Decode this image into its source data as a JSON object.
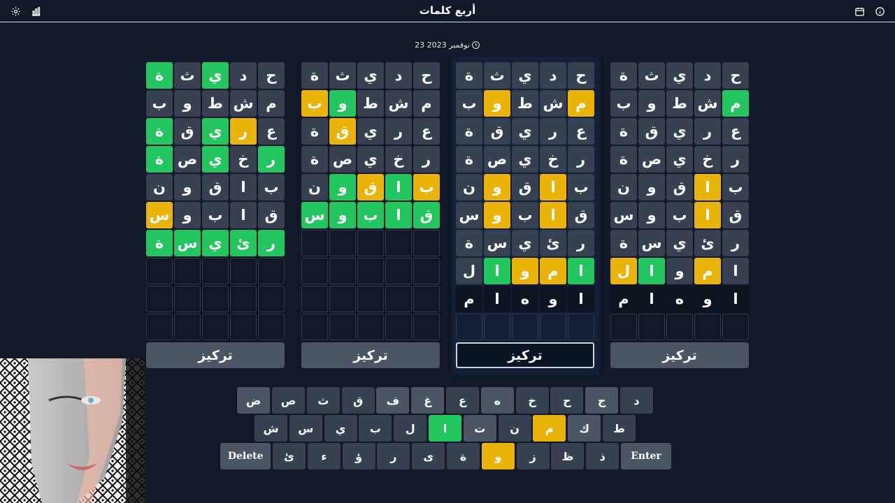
{
  "header": {
    "title": "أربع كلمات"
  },
  "date": {
    "text": "23 نوفمبر 2023"
  },
  "boards": [
    {
      "rows": [
        {
          "letters": [
            "ح",
            "د",
            "ي",
            "ث",
            "ة"
          ],
          "states": [
            "n",
            "n",
            "n",
            "n",
            "n"
          ]
        },
        {
          "letters": [
            "م",
            "ش",
            "ط",
            "و",
            "ب"
          ],
          "states": [
            "g",
            "n",
            "n",
            "n",
            "n"
          ]
        },
        {
          "letters": [
            "ع",
            "ر",
            "ي",
            "ق",
            "ة"
          ],
          "states": [
            "n",
            "n",
            "n",
            "n",
            "n"
          ]
        },
        {
          "letters": [
            "ر",
            "خ",
            "ي",
            "ص",
            "ة"
          ],
          "states": [
            "n",
            "n",
            "n",
            "n",
            "n"
          ]
        },
        {
          "letters": [
            "ب",
            "ا",
            "ق",
            "و",
            "ن"
          ],
          "states": [
            "n",
            "y",
            "n",
            "n",
            "n"
          ]
        },
        {
          "letters": [
            "ق",
            "ا",
            "ب",
            "و",
            "س"
          ],
          "states": [
            "n",
            "y",
            "n",
            "n",
            "n"
          ]
        },
        {
          "letters": [
            "ر",
            "ئ",
            "ي",
            "س",
            "ة"
          ],
          "states": [
            "n",
            "n",
            "n",
            "n",
            "n"
          ]
        },
        {
          "letters": [
            "ا",
            "م",
            "و",
            "ا",
            "ل"
          ],
          "states": [
            "n",
            "y",
            "n",
            "g",
            "y"
          ]
        },
        {
          "letters": [
            "ا",
            "و",
            "ه",
            "ا",
            "م"
          ],
          "states": [
            "t",
            "t",
            "t",
            "t",
            "t"
          ]
        },
        {
          "letters": [
            "",
            "",
            "",
            "",
            ""
          ],
          "states": [
            "e",
            "e",
            "e",
            "e",
            "e"
          ]
        }
      ],
      "focus_label": "تركيز"
    },
    {
      "rows": [
        {
          "letters": [
            "ح",
            "د",
            "ي",
            "ث",
            "ة"
          ],
          "states": [
            "n",
            "n",
            "n",
            "n",
            "n"
          ]
        },
        {
          "letters": [
            "م",
            "ش",
            "ط",
            "و",
            "ب"
          ],
          "states": [
            "y",
            "n",
            "n",
            "y",
            "n"
          ]
        },
        {
          "letters": [
            "ع",
            "ر",
            "ي",
            "ق",
            "ة"
          ],
          "states": [
            "n",
            "n",
            "n",
            "n",
            "n"
          ]
        },
        {
          "letters": [
            "ر",
            "خ",
            "ي",
            "ص",
            "ة"
          ],
          "states": [
            "n",
            "n",
            "n",
            "n",
            "n"
          ]
        },
        {
          "letters": [
            "ب",
            "ا",
            "ق",
            "و",
            "ن"
          ],
          "states": [
            "n",
            "y",
            "n",
            "y",
            "n"
          ]
        },
        {
          "letters": [
            "ق",
            "ا",
            "ب",
            "و",
            "س"
          ],
          "states": [
            "n",
            "y",
            "n",
            "y",
            "n"
          ]
        },
        {
          "letters": [
            "ر",
            "ئ",
            "ي",
            "س",
            "ة"
          ],
          "states": [
            "n",
            "n",
            "n",
            "n",
            "n"
          ]
        },
        {
          "letters": [
            "ا",
            "م",
            "و",
            "ا",
            "ل"
          ],
          "states": [
            "g",
            "y",
            "y",
            "g",
            "n"
          ]
        },
        {
          "letters": [
            "ا",
            "و",
            "ه",
            "ا",
            "م"
          ],
          "states": [
            "t",
            "t",
            "t",
            "t",
            "t"
          ]
        },
        {
          "letters": [
            "",
            "",
            "",
            "",
            ""
          ],
          "states": [
            "e",
            "e",
            "e",
            "e",
            "e"
          ]
        }
      ],
      "focus_label": "تركيز"
    },
    {
      "rows": [
        {
          "letters": [
            "ح",
            "د",
            "ي",
            "ث",
            "ة"
          ],
          "states": [
            "n",
            "n",
            "n",
            "n",
            "n"
          ]
        },
        {
          "letters": [
            "م",
            "ش",
            "ط",
            "و",
            "ب"
          ],
          "states": [
            "n",
            "n",
            "n",
            "g",
            "y"
          ]
        },
        {
          "letters": [
            "ع",
            "ر",
            "ي",
            "ق",
            "ة"
          ],
          "states": [
            "n",
            "n",
            "n",
            "y",
            "n"
          ]
        },
        {
          "letters": [
            "ر",
            "خ",
            "ي",
            "ص",
            "ة"
          ],
          "states": [
            "n",
            "n",
            "n",
            "n",
            "n"
          ]
        },
        {
          "letters": [
            "ب",
            "ا",
            "ق",
            "و",
            "ن"
          ],
          "states": [
            "y",
            "g",
            "y",
            "g",
            "n"
          ]
        },
        {
          "letters": [
            "ق",
            "ا",
            "ب",
            "و",
            "س"
          ],
          "states": [
            "g",
            "g",
            "g",
            "g",
            "g"
          ]
        },
        {
          "letters": [
            "",
            "",
            "",
            "",
            ""
          ],
          "states": [
            "e",
            "e",
            "e",
            "e",
            "e"
          ]
        },
        {
          "letters": [
            "",
            "",
            "",
            "",
            ""
          ],
          "states": [
            "e",
            "e",
            "e",
            "e",
            "e"
          ]
        },
        {
          "letters": [
            "",
            "",
            "",
            "",
            ""
          ],
          "states": [
            "e",
            "e",
            "e",
            "e",
            "e"
          ]
        },
        {
          "letters": [
            "",
            "",
            "",
            "",
            ""
          ],
          "states": [
            "e",
            "e",
            "e",
            "e",
            "e"
          ]
        }
      ],
      "focus_label": "تركيز"
    },
    {
      "rows": [
        {
          "letters": [
            "ح",
            "د",
            "ي",
            "ث",
            "ة"
          ],
          "states": [
            "n",
            "n",
            "g",
            "n",
            "g"
          ]
        },
        {
          "letters": [
            "م",
            "ش",
            "ط",
            "و",
            "ب"
          ],
          "states": [
            "n",
            "n",
            "n",
            "n",
            "n"
          ]
        },
        {
          "letters": [
            "ع",
            "ر",
            "ي",
            "ق",
            "ة"
          ],
          "states": [
            "n",
            "y",
            "g",
            "n",
            "g"
          ]
        },
        {
          "letters": [
            "ر",
            "خ",
            "ي",
            "ص",
            "ة"
          ],
          "states": [
            "g",
            "n",
            "g",
            "n",
            "g"
          ]
        },
        {
          "letters": [
            "ب",
            "ا",
            "ق",
            "و",
            "ن"
          ],
          "states": [
            "n",
            "n",
            "n",
            "n",
            "n"
          ]
        },
        {
          "letters": [
            "ق",
            "ا",
            "ب",
            "و",
            "س"
          ],
          "states": [
            "n",
            "n",
            "n",
            "n",
            "y"
          ]
        },
        {
          "letters": [
            "ر",
            "ئ",
            "ي",
            "س",
            "ة"
          ],
          "states": [
            "g",
            "g",
            "g",
            "g",
            "g"
          ]
        },
        {
          "letters": [
            "",
            "",
            "",
            "",
            ""
          ],
          "states": [
            "e",
            "e",
            "e",
            "e",
            "e"
          ]
        },
        {
          "letters": [
            "",
            "",
            "",
            "",
            ""
          ],
          "states": [
            "e",
            "e",
            "e",
            "e",
            "e"
          ]
        },
        {
          "letters": [
            "",
            "",
            "",
            "",
            ""
          ],
          "states": [
            "e",
            "e",
            "e",
            "e",
            "e"
          ]
        }
      ],
      "focus_label": "تركيز"
    }
  ],
  "keyboard": {
    "rows": [
      [
        {
          "label": "د",
          "state": "n"
        },
        {
          "label": "ج",
          "state": "l"
        },
        {
          "label": "ح",
          "state": "n"
        },
        {
          "label": "خ",
          "state": "n"
        },
        {
          "label": "ه",
          "state": "l"
        },
        {
          "label": "ع",
          "state": "n"
        },
        {
          "label": "غ",
          "state": "l"
        },
        {
          "label": "ف",
          "state": "l"
        },
        {
          "label": "ق",
          "state": "n"
        },
        {
          "label": "ث",
          "state": "n"
        },
        {
          "label": "ص",
          "state": "n"
        },
        {
          "label": "ض",
          "state": "l"
        }
      ],
      [
        {
          "label": "ط",
          "state": "n"
        },
        {
          "label": "ك",
          "state": "l"
        },
        {
          "label": "م",
          "state": "y"
        },
        {
          "label": "ن",
          "state": "n"
        },
        {
          "label": "ت",
          "state": "l"
        },
        {
          "label": "ا",
          "state": "g"
        },
        {
          "label": "ل",
          "state": "n"
        },
        {
          "label": "ب",
          "state": "n"
        },
        {
          "label": "ي",
          "state": "n"
        },
        {
          "label": "س",
          "state": "n"
        },
        {
          "label": "ش",
          "state": "n"
        }
      ],
      [
        {
          "label": "Enter",
          "state": "w"
        },
        {
          "label": "ذ",
          "state": "n"
        },
        {
          "label": "ظ",
          "state": "n"
        },
        {
          "label": "ز",
          "state": "n"
        },
        {
          "label": "و",
          "state": "y"
        },
        {
          "label": "ة",
          "state": "n"
        },
        {
          "label": "ى",
          "state": "n"
        },
        {
          "label": "ر",
          "state": "n"
        },
        {
          "label": "ؤ",
          "state": "n"
        },
        {
          "label": "ء",
          "state": "n"
        },
        {
          "label": "ئ",
          "state": "n"
        },
        {
          "label": "Delete",
          "state": "w"
        }
      ]
    ]
  }
}
